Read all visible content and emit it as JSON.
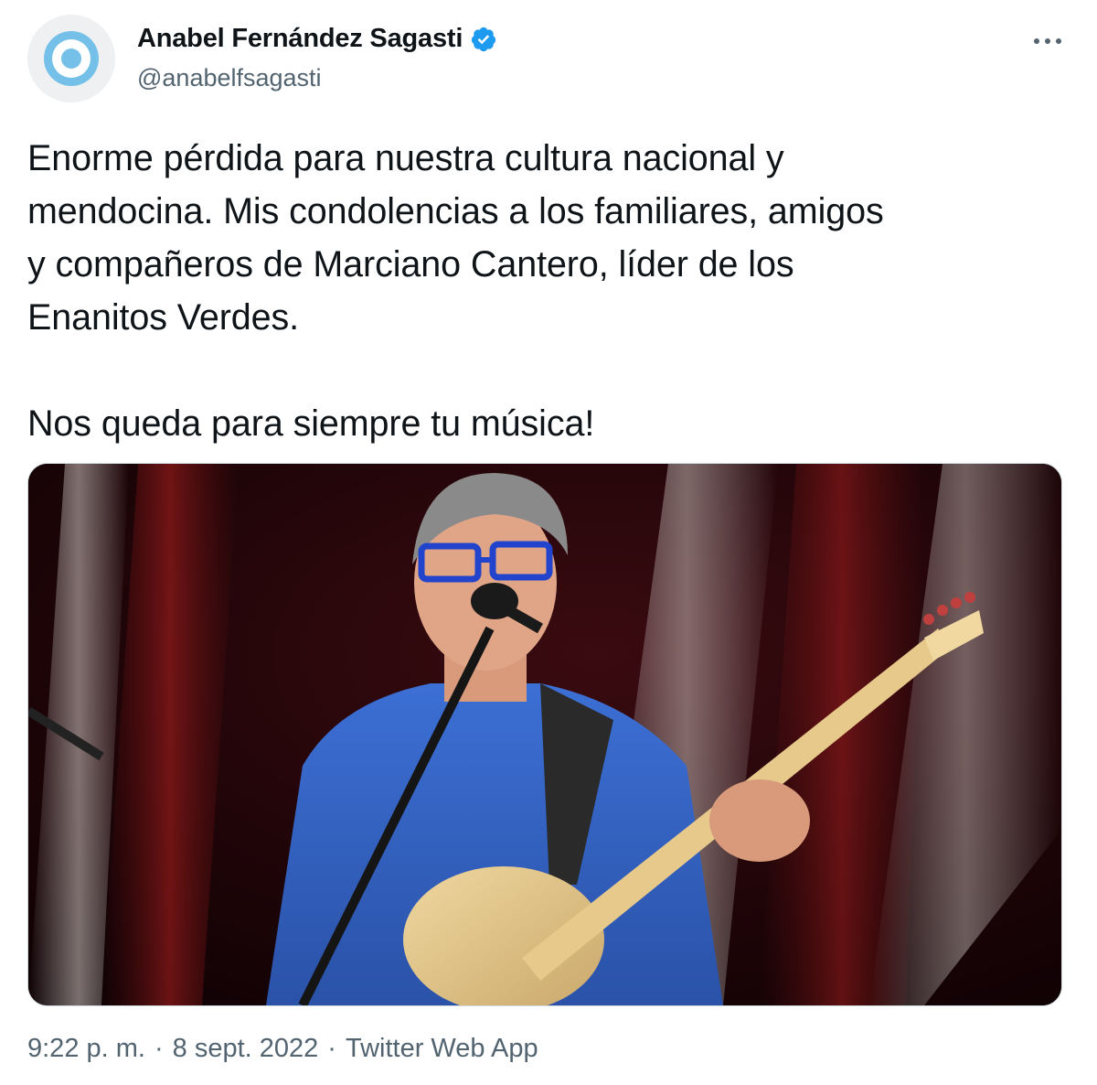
{
  "author": {
    "display_name": "Anabel Fernández Sagasti",
    "handle": "@anabelfsagasti",
    "verified": true,
    "avatar_icon": "argentina-cockade-avatar",
    "colors": {
      "cockade_blue": "#74c0e8",
      "verified_blue": "#1d9bf0"
    }
  },
  "tweet": {
    "text": "Enorme pérdida para nuestra cultura nacional y\nmendocina. Mis condolencias a los familiares, amigos\ny compañeros de Marciano Cantero, líder de los\nEnanitos Verdes.\n\nNos queda para siempre tu música!"
  },
  "media": {
    "kind": "photo",
    "subject": "musician-singing-with-bass-guitar"
  },
  "meta": {
    "time": "9:22 p. m.",
    "separator": "·",
    "date": "8 sept. 2022",
    "source": "Twitter Web App"
  },
  "menu": {
    "icon": "more-horizontal-icon"
  }
}
